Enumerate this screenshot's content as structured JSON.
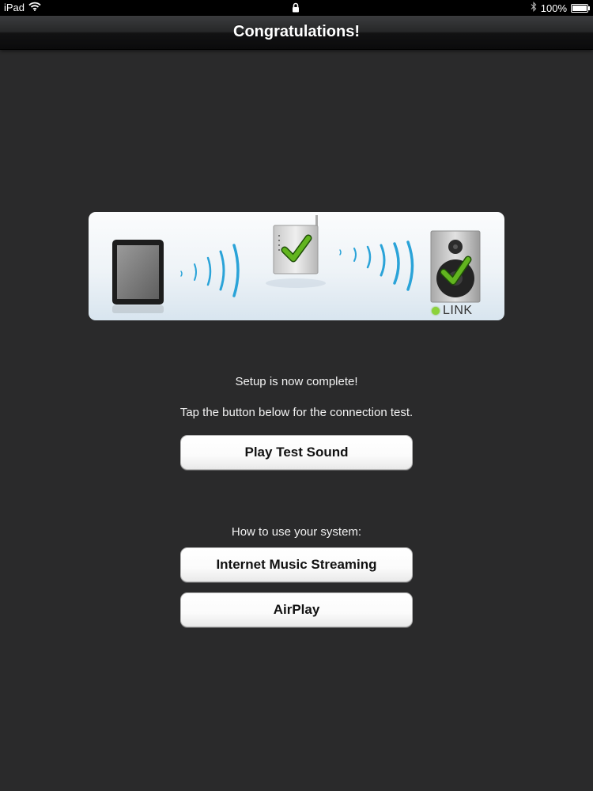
{
  "status_bar": {
    "device": "iPad",
    "battery": "100%",
    "icons": [
      "wifi-icon",
      "lock-icon",
      "bluetooth-icon",
      "battery-icon"
    ]
  },
  "nav": {
    "title": "Congratulations!"
  },
  "diagram": {
    "icons": [
      "ipad-icon",
      "wireless-router-icon",
      "speaker-icon",
      "checkmark-icon"
    ],
    "link_label": "LINK",
    "link_color": "#8cd23a"
  },
  "messages": {
    "setup_complete": "Setup is now complete!",
    "tap_instruction": "Tap the button below for the connection test.",
    "how_to_use": "How to use your system:"
  },
  "buttons": {
    "play_test_sound": "Play Test Sound",
    "internet_music_streaming": "Internet Music Streaming",
    "airplay": "AirPlay"
  },
  "colors": {
    "background": "#2a2a2b",
    "wave_blue": "#2aa3d8",
    "check_green": "#62b51f"
  }
}
